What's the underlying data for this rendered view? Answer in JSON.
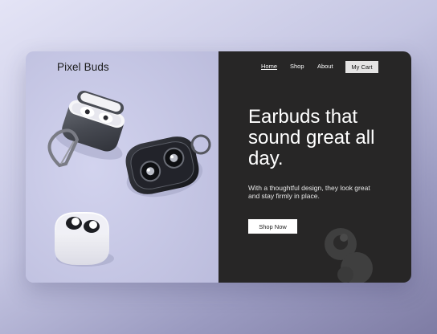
{
  "brand": {
    "name": "Pixel Buds"
  },
  "nav": {
    "items": [
      {
        "label": "Home",
        "active": true
      },
      {
        "label": "Shop",
        "active": false
      },
      {
        "label": "About",
        "active": false
      }
    ],
    "cart_label": "My Cart"
  },
  "hero": {
    "headline": "Earbuds that sound great all day.",
    "subtext": "With a thoughtful design, they look great and stay firmly in place.",
    "cta_label": "Shop Now"
  },
  "colors": {
    "left_panel": "#c7c8e6",
    "right_panel": "#272626",
    "cart_button": "#e5e4e4",
    "cta_button": "#ffffff"
  },
  "icons": {
    "product_photo": "earbuds-product-photo",
    "decoration": "earbud-silhouette-icon"
  }
}
